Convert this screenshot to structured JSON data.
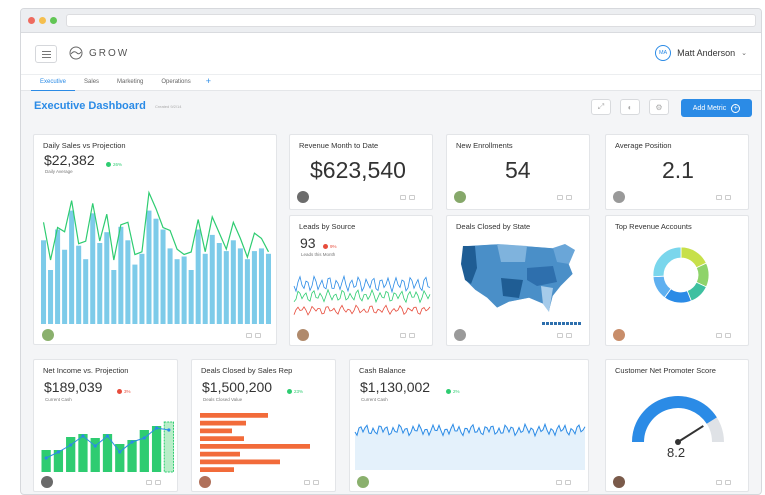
{
  "app": {
    "logo_text": "GROW",
    "user_name": "Matt Anderson",
    "user_initials": "MA"
  },
  "tabs": [
    "Executive",
    "Sales",
    "Marketing",
    "Operations"
  ],
  "header": {
    "title": "Executive Dashboard",
    "subtitle": "Created 9/2/14",
    "add_metric": "Add Metric"
  },
  "colors": {
    "accent": "#2b8be6",
    "bar_blue": "#7dcbe9",
    "green": "#2ecc71",
    "red": "#e74c3c",
    "orange": "#f26b3a",
    "navy": "#1f5d94"
  },
  "cards": {
    "daily_sales": {
      "title": "Daily Sales vs Projection",
      "value": "$22,382",
      "change": "26%",
      "label": "Daily Average"
    },
    "revenue": {
      "title": "Revenue Month to Date",
      "value": "$623,540"
    },
    "enrollments": {
      "title": "New Enrollments",
      "value": "54"
    },
    "avg_position": {
      "title": "Average Position",
      "value": "2.1"
    },
    "leads": {
      "title": "Leads by Source",
      "value": "93",
      "change": "9%",
      "label": "Leads this Month"
    },
    "deals_state": {
      "title": "Deals Closed by State"
    },
    "top_revenue": {
      "title": "Top Revenue Accounts"
    },
    "net_income": {
      "title": "Net Income vs. Projection",
      "value": "$189,039",
      "change": "3%",
      "label": "Current Cash"
    },
    "deals_rep": {
      "title": "Deals Closed by Sales Rep",
      "value": "$1,500,200",
      "change": "23%",
      "label": "Deals Closed Value"
    },
    "cash": {
      "title": "Cash Balance",
      "value": "$1,130,002",
      "change": "2%",
      "label": "Current Cash"
    },
    "nps": {
      "title": "Customer Net Promoter Score",
      "value": "8.2"
    }
  },
  "chart_data": [
    {
      "type": "bar",
      "title": "Daily Sales vs Projection",
      "values": [
        62,
        40,
        70,
        55,
        84,
        58,
        48,
        82,
        60,
        68,
        40,
        72,
        62,
        44,
        52,
        84,
        78,
        70,
        56,
        48,
        50,
        40,
        70,
        52,
        66,
        60,
        54,
        62,
        56,
        48,
        54,
        56,
        52
      ]
    },
    {
      "type": "bar",
      "title": "Net Income vs. Projection",
      "values": [
        22,
        22,
        35,
        38,
        34,
        38,
        28,
        32,
        42,
        46,
        50
      ]
    },
    {
      "type": "bar",
      "title": "Deals Closed by Sales Rep",
      "values": [
        68,
        46,
        32,
        44,
        110,
        40,
        80,
        34
      ]
    },
    {
      "type": "pie",
      "title": "Top Revenue Accounts",
      "values": [
        18,
        14,
        12,
        16,
        14,
        26
      ]
    },
    {
      "type": "gauge",
      "title": "Customer Net Promoter Score",
      "value": 8.2,
      "ylim": [
        0,
        10
      ]
    }
  ]
}
